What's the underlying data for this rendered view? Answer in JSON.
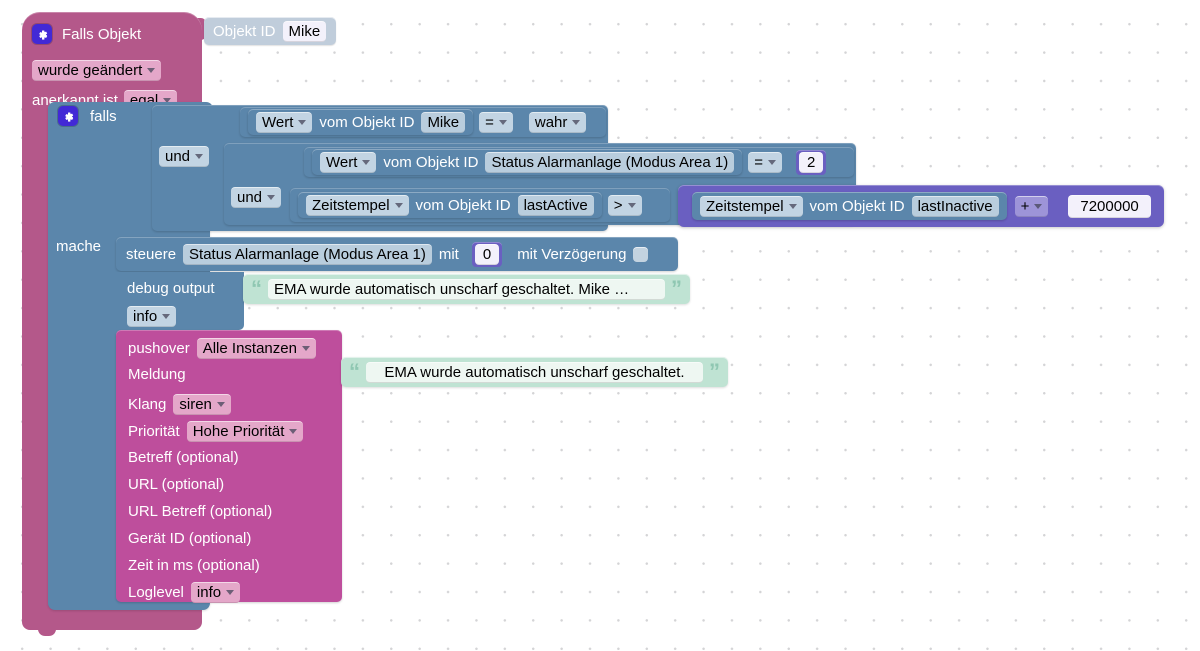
{
  "workspace": {
    "background": "#ffffff",
    "grid_dot_color": "#d4d4d6"
  },
  "event_block": {
    "color": "#b4588a",
    "gear_icon": "gear-icon",
    "title": "Falls Objekt",
    "trigger_mode": "wurde geändert",
    "ack_label": "anerkannt ist",
    "ack_value": "egal",
    "object_id_block": {
      "color": "#c0cddb",
      "label": "Objekt ID",
      "value": "Mike"
    }
  },
  "if_block": {
    "color": "#5b86ab",
    "gear_icon": "gear-icon",
    "if_label": "falls",
    "do_label": "mache"
  },
  "conditions": {
    "logic_op_outer": "und",
    "logic_op_inner": "und",
    "comparison_1": {
      "getter_kind": "Wert",
      "getter_of_label": "vom Objekt ID",
      "getter_value": "Mike",
      "operator": "=",
      "compare_to": "wahr"
    },
    "comparison_2": {
      "getter_kind": "Wert",
      "getter_of_label": "vom Objekt ID",
      "getter_value": "Status Alarmanlage (Modus Area 1)",
      "operator": "=",
      "compare_to_number": "2"
    },
    "comparison_3": {
      "getter_kind": "Zeitstempel",
      "getter_of_label": "vom Objekt ID",
      "getter_value": "lastActive",
      "operator": ">",
      "math": {
        "color": "#6a5fc1",
        "getter_kind": "Zeitstempel",
        "getter_of_label": "vom Objekt ID",
        "getter_value": "lastInactive",
        "operator": "+",
        "operand": "7200000"
      }
    }
  },
  "statements": {
    "control": {
      "verb": "steuere",
      "target": "Status Alarmanlage (Modus Area 1)",
      "with_label": "mit",
      "value": "0",
      "delay_label": "mit Verzögerung",
      "delay_checkbox": "unchecked-checkbox"
    },
    "debug": {
      "label": "debug output",
      "level": "info",
      "text": "EMA wurde automatisch unscharf geschaltet. Mike …"
    },
    "pushover": {
      "color": "#be4e9c",
      "title": "pushover",
      "instance": "Alle Instanzen",
      "message_label": "Meldung",
      "message_text": "EMA wurde automatisch unscharf geschaltet.",
      "sound_label": "Klang",
      "sound_value": "siren",
      "priority_label": "Priorität",
      "priority_value": "Hohe Priorität",
      "optional_fields": [
        "Betreff (optional)",
        "URL (optional)",
        "URL Betreff (optional)",
        "Gerät ID (optional)",
        "Zeit in ms (optional)"
      ],
      "loglevel_label": "Loglevel",
      "loglevel_value": "info"
    }
  }
}
